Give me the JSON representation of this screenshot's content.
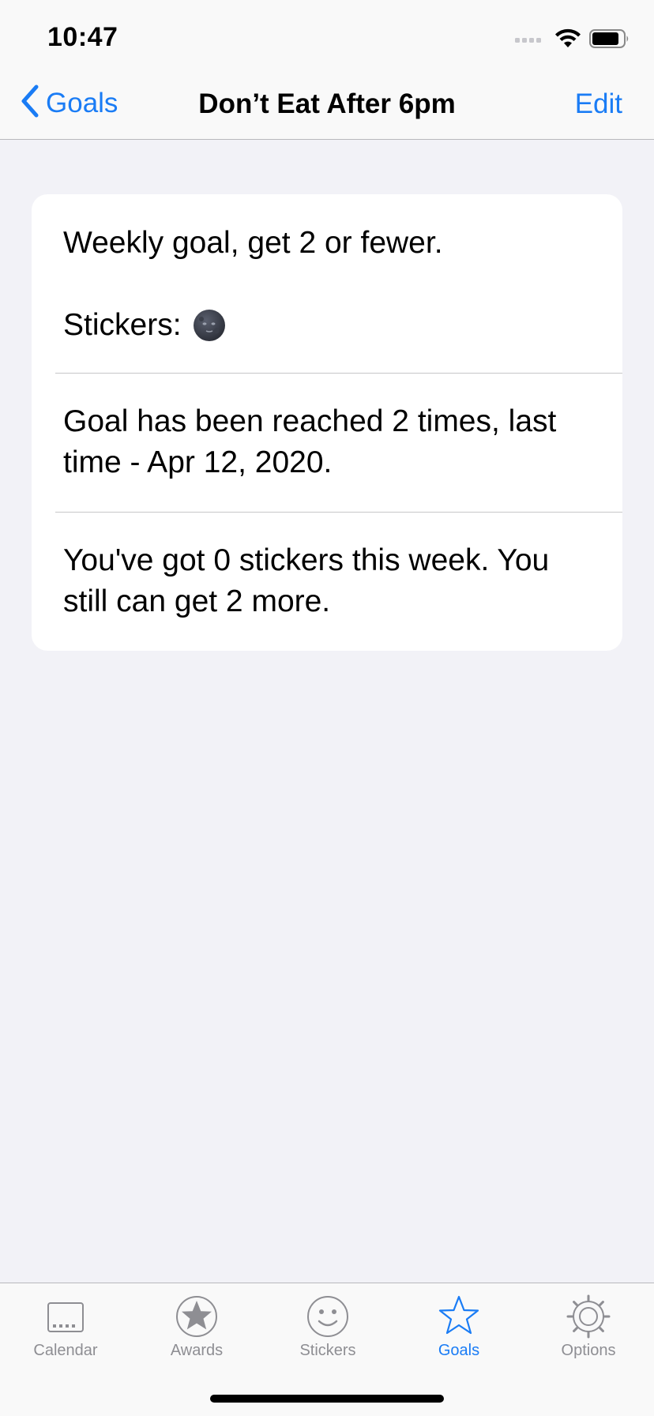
{
  "status_bar": {
    "time": "10:47"
  },
  "nav": {
    "back_label": "Goals",
    "title": "Don’t Eat After 6pm",
    "edit_label": "Edit"
  },
  "card": {
    "weekly_goal_text": "Weekly goal, get 2 or fewer.",
    "stickers_label": "Stickers:",
    "sticker_icon": "new-moon-face-emoji",
    "reached_text": "Goal has been reached 2 times, last time - Apr 12, 2020.",
    "progress_text": "You've got 0 stickers this week. You still can get 2 more."
  },
  "tabbar": {
    "active_tab": "Goals",
    "tabs": [
      {
        "label": "Calendar",
        "icon": "calendar-icon"
      },
      {
        "label": "Awards",
        "icon": "award-star-icon"
      },
      {
        "label": "Stickers",
        "icon": "smiley-icon"
      },
      {
        "label": "Goals",
        "icon": "star-outline-icon"
      },
      {
        "label": "Options",
        "icon": "gear-icon"
      }
    ]
  },
  "colors": {
    "accent": "#1a7cf5",
    "inactive": "#8e8e93",
    "background": "#f2f2f7",
    "card": "#ffffff"
  }
}
